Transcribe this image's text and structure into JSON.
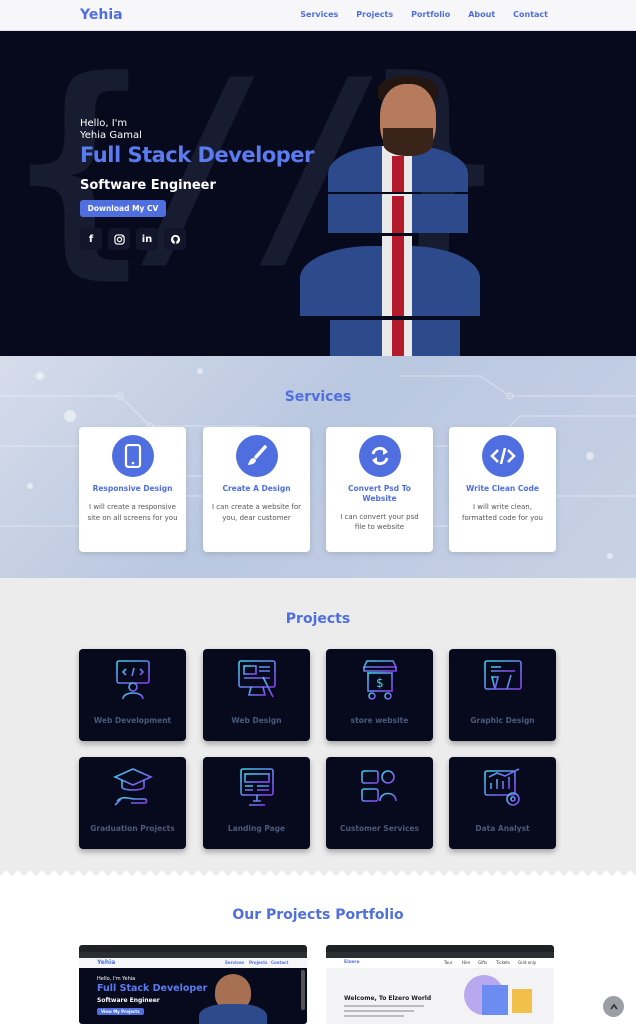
{
  "nav": {
    "brand": "Yehia",
    "links": [
      "Services",
      "Projects",
      "Portfolio",
      "About",
      "Contact"
    ]
  },
  "hero": {
    "hello": "Hello, I'm",
    "name": "Yehia Gamal",
    "role": "Full Stack Developer",
    "subrole": "Software Engineer",
    "cv_button": "Download My CV",
    "socials": [
      "facebook-icon",
      "instagram-icon",
      "linkedin-icon",
      "github-icon"
    ]
  },
  "services": {
    "title": "Services",
    "cards": [
      {
        "icon": "phone-icon",
        "title": "Responsive Design",
        "desc": "I will create a responsive site on all screens for you"
      },
      {
        "icon": "brush-icon",
        "title": "Create A Design",
        "desc": "I can create a website for you, dear customer"
      },
      {
        "icon": "sync-icon",
        "title": "Convert Psd To Website",
        "desc": "I can convert your psd file to website"
      },
      {
        "icon": "code-icon",
        "title": "Write Clean Code",
        "desc": "I will write clean, formatted code for you"
      }
    ]
  },
  "projects": {
    "title": "Projects",
    "cards": [
      {
        "icon": "web-development-icon",
        "label": "Web Development"
      },
      {
        "icon": "web-design-icon",
        "label": "Web Design"
      },
      {
        "icon": "store-icon",
        "label": "store website"
      },
      {
        "icon": "graphic-design-icon",
        "label": "Graphic Design"
      },
      {
        "icon": "graduation-cap-icon",
        "label": "Graduation Projects"
      },
      {
        "icon": "landing-page-icon",
        "label": "Landing Page"
      },
      {
        "icon": "customer-services-icon",
        "label": "Customer Services"
      },
      {
        "icon": "data-analyst-icon",
        "label": "Data Analyst"
      }
    ]
  },
  "portfolio": {
    "title": "Our Projects Portfolio",
    "shot1": {
      "brand": "Yehia",
      "links": [
        "Services",
        "Projects",
        "Contact"
      ],
      "hello": "Hello, I'm Yehia",
      "role": "Full Stack Developer",
      "subrole": "Software Engineer",
      "button": "View My Projects"
    },
    "shot2": {
      "brand": "Elzero",
      "links": [
        "Tour",
        "Hire",
        "Gifts",
        "Tickets",
        "Grid only"
      ],
      "heading": "Welcome, To Elzero World"
    }
  },
  "colors": {
    "accent": "#4f6fe0",
    "hero_bg": "#070a1c",
    "card_bg": "#070a1c"
  }
}
